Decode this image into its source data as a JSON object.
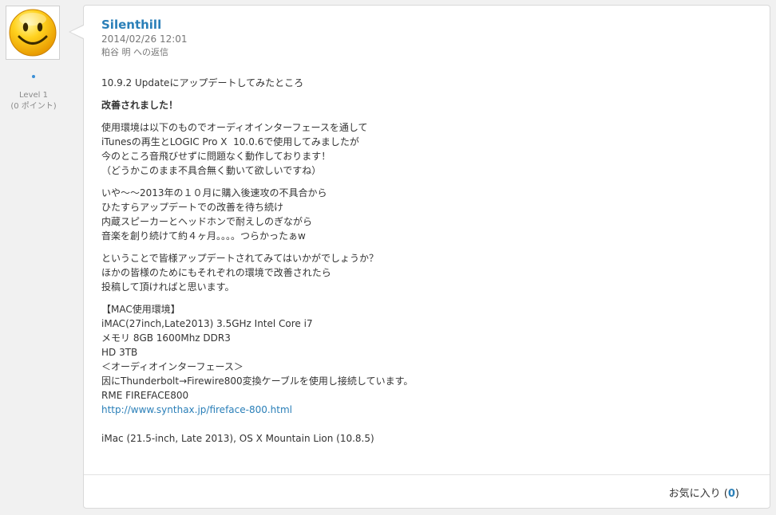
{
  "author": {
    "level": "Level 1",
    "points": "(0 ポイント)"
  },
  "post": {
    "author_name": "Silenthill",
    "date": "2014/02/26 12:01",
    "reply_to": "粕谷 明 への返信",
    "paragraphs": [
      [
        "10.9.2 Updateにアップデートしてみたところ"
      ],
      [
        "改善されました！"
      ],
      [
        "使用環境は以下のものでオーディオインターフェースを通して",
        "iTunesの再生とLOGIC Pro X  10.0.6で使用してみましたが",
        "今のところ音飛びせずに問題なく動作しております！",
        "（どうかこのまま不具合無く動いて欲しいですね）"
      ],
      [
        "いや〜〜2013年の１０月に購入後速攻の不具合から",
        "ひたすらアップデートでの改善を待ち続け",
        "内蔵スピーカーとヘッドホンで耐えしのぎながら",
        "音楽を創り続けて約４ヶ月。。。。つらかったぁw"
      ],
      [
        "ということで皆様アップデートされてみてはいかがでしょうか？",
        "ほかの皆様のためにもそれぞれの環境で改善されたら",
        "投稿して頂ければと思います。"
      ],
      [
        "【MAC使用環境】",
        "iMAC(27inch,Late2013) 3.5GHz Intel Core i7",
        "メモリ 8GB 1600Mhz DDR3",
        "HD 3TB",
        "＜オーディオインターフェース＞",
        "因にThunderbolt→Firewire800変換ケーブルを使用し接続しています。",
        "RME FIREFACE800"
      ]
    ],
    "link": "http://www.synthax.jp/fireface-800.html",
    "signature": "iMac (21.5-inch, Late 2013), OS X Mountain Lion (10.8.5)",
    "likes_label": "お気に入り",
    "likes_count": "0"
  },
  "colors": {
    "accent": "#2a7fb8",
    "background": "#f1f1f1"
  },
  "icons": {
    "avatar": "smiley-face-icon",
    "status": "online-dot-icon"
  }
}
